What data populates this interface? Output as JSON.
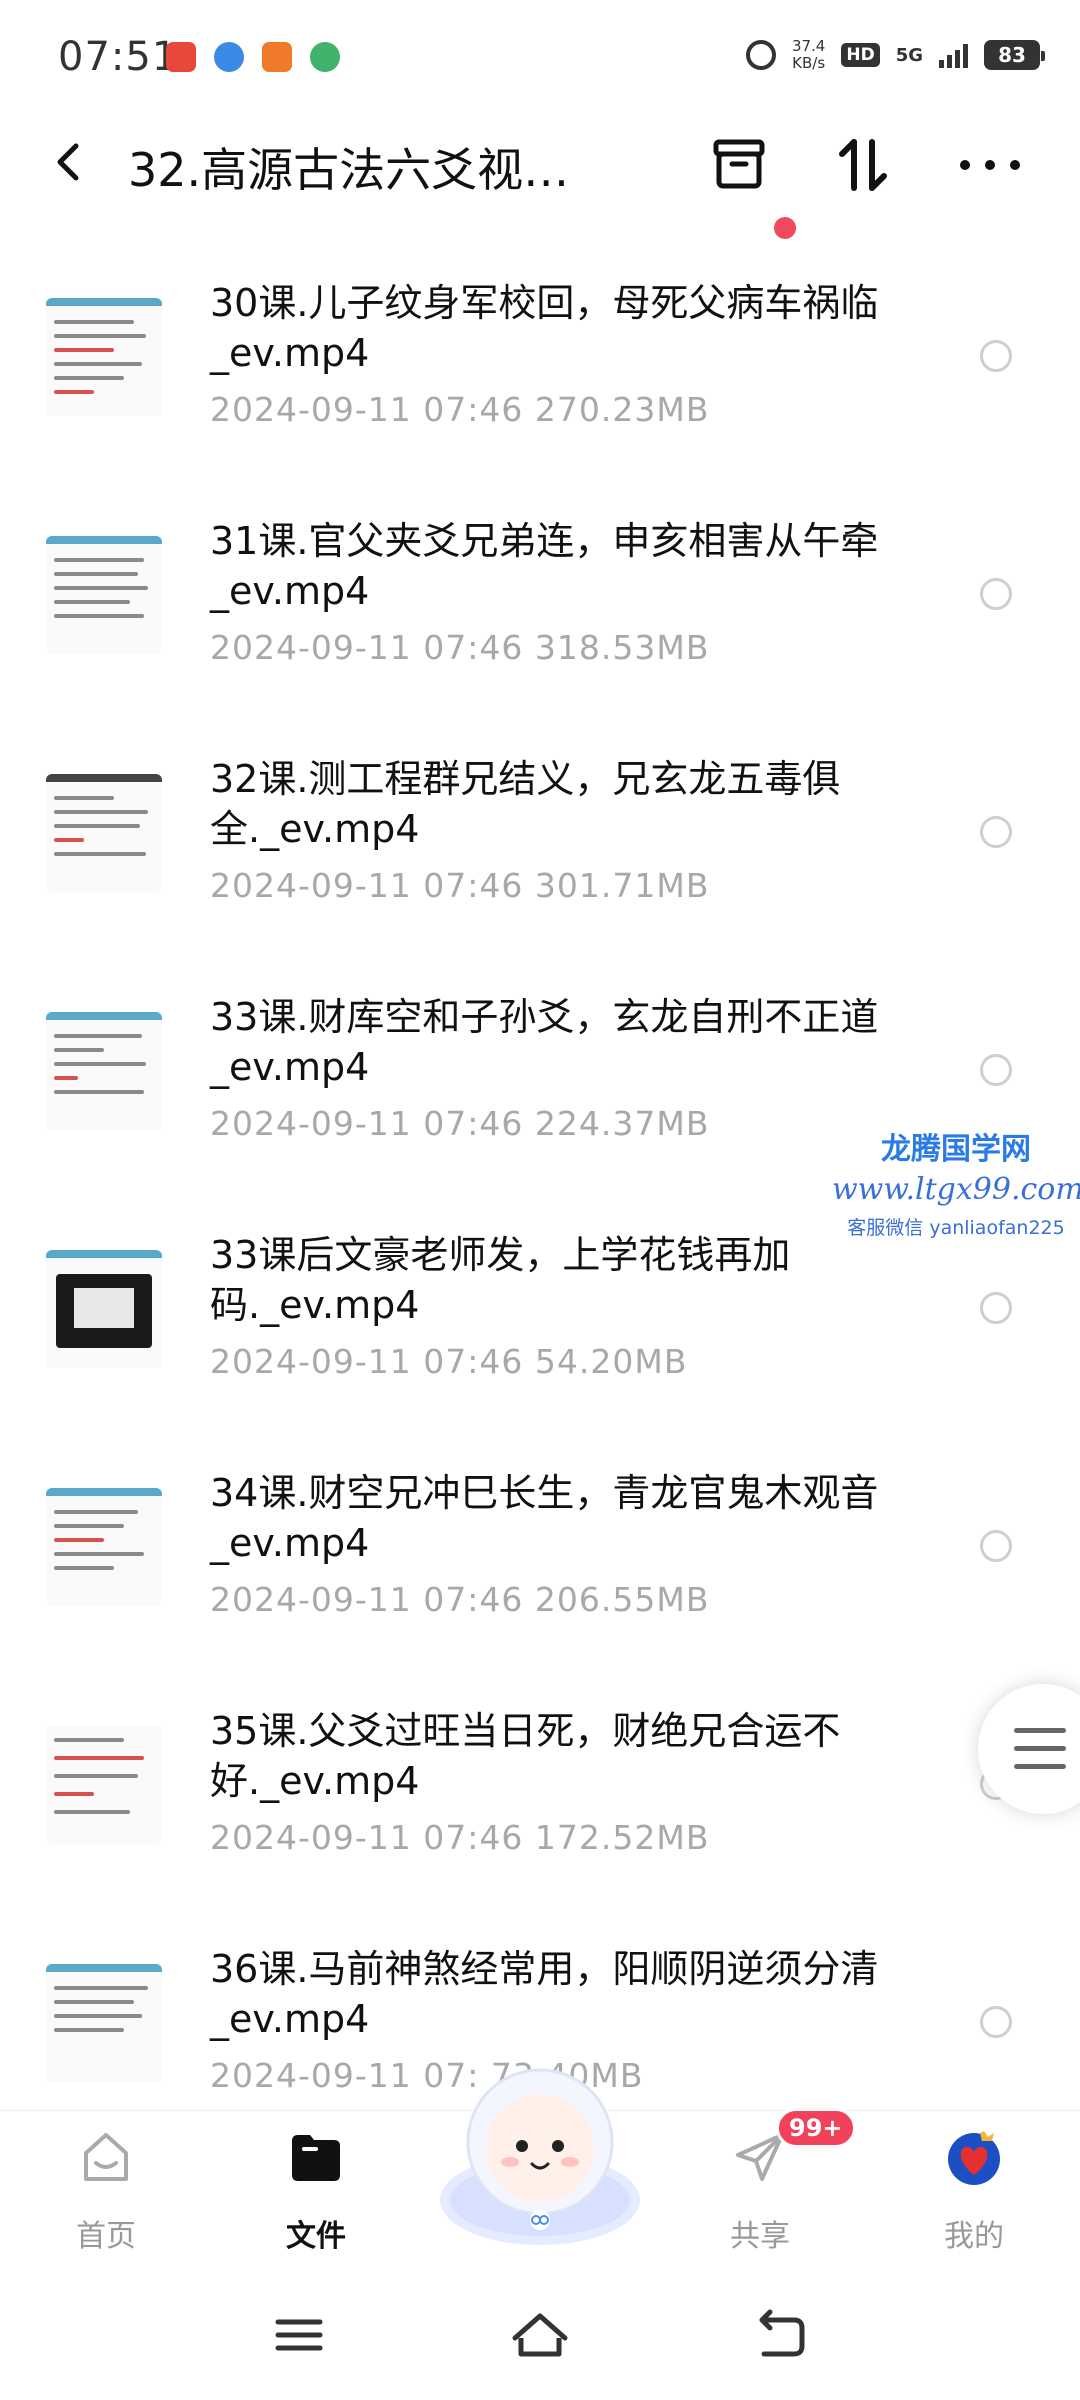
{
  "status_bar": {
    "time": "07:51",
    "net_speed_value": "37.4",
    "net_speed_unit": "KB/s",
    "hd": "HD",
    "network": "5G",
    "battery": "83",
    "app_icon_colors": [
      "#e8483a",
      "#3b8be6",
      "#f07a2a",
      "#3fb36b"
    ]
  },
  "header": {
    "title": "32.高源古法六爻视…",
    "icons": [
      "back-arrow",
      "archive-box",
      "sort-arrows",
      "more-dots"
    ],
    "notification_dot_color": "#f04a5c"
  },
  "files": [
    {
      "name": "30课.儿子纹身军校回，母死父病车祸临_ev.mp4",
      "date": "2024-09-11",
      "time": "07:46",
      "size": "270.23MB"
    },
    {
      "name": "31课.官父夹爻兄弟连，申亥相害从午牵_ev.mp4",
      "date": "2024-09-11",
      "time": "07:46",
      "size": "318.53MB"
    },
    {
      "name": "32课.测工程群兄结义，兄玄龙五毒俱全._ev.mp4",
      "date": "2024-09-11",
      "time": "07:46",
      "size": "301.71MB"
    },
    {
      "name": "33课.财库空和子孙爻，玄龙自刑不正道_ev.mp4",
      "date": "2024-09-11",
      "time": "07:46",
      "size": "224.37MB"
    },
    {
      "name": "33课后文豪老师发，上学花钱再加码._ev.mp4",
      "date": "2024-09-11",
      "time": "07:46",
      "size": "54.20MB"
    },
    {
      "name": "34课.财空兄冲巳长生，青龙官鬼木观音_ev.mp4",
      "date": "2024-09-11",
      "time": "07:46",
      "size": "206.55MB"
    },
    {
      "name": "35课.父爻过旺当日死，财绝兄合运不好._ev.mp4",
      "date": "2024-09-11",
      "time": "07:46",
      "size": "172.52MB"
    },
    {
      "name": "36课.马前神煞经常用，阳顺阴逆须分清_ev.mp4",
      "date": "2024-09-11",
      "time": "07:",
      "size": "73.40MB"
    }
  ],
  "watermark": {
    "title": "龙腾国学网",
    "url": "www.ltgx99.com",
    "contact": "客服微信 yanliaofan225"
  },
  "bottom_nav": {
    "tabs": [
      {
        "label": "首页",
        "icon": "home-face-icon",
        "active": false
      },
      {
        "label": "文件",
        "icon": "folder-icon",
        "active": true
      },
      {
        "label": "共享",
        "icon": "paper-plane-icon",
        "active": false
      },
      {
        "label": "我的",
        "icon": "avatar-icon",
        "active": false
      }
    ],
    "share_badge": "99+",
    "accent_color": "#111111"
  }
}
